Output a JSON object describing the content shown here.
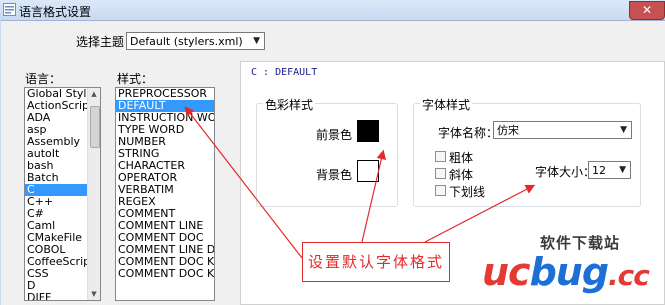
{
  "window": {
    "title": "语言格式设置",
    "close_label": "✕"
  },
  "theme": {
    "label": "选择主题",
    "selected": "Default (stylers.xml)"
  },
  "language_list": {
    "label": "语言：",
    "items": [
      "Global Styles",
      "ActionScript",
      "ADA",
      "asp",
      "Assembly",
      "autoIt",
      "bash",
      "Batch",
      "C",
      "C++",
      "C#",
      "Caml",
      "CMakeFile",
      "COBOL",
      "CoffeeScript",
      "CSS",
      "D",
      "DIFF"
    ],
    "selected_index": 8
  },
  "style_list": {
    "label": "样式：",
    "items": [
      "PREPROCESSOR",
      "DEFAULT",
      "INSTRUCTION WORD",
      "TYPE WORD",
      "NUMBER",
      "STRING",
      "CHARACTER",
      "OPERATOR",
      "VERBATIM",
      "REGEX",
      "COMMENT",
      "COMMENT LINE",
      "COMMENT DOC",
      "COMMENT LINE DOC",
      "COMMENT DOC KEYWORD",
      "COMMENT DOC KEYWORD"
    ],
    "selected_index": 1
  },
  "panel": {
    "title": "C : DEFAULT"
  },
  "color_style": {
    "caption": "色彩样式",
    "foreground_label": "前景色",
    "background_label": "背景色",
    "foreground_color": "#000000",
    "background_color": "#ffffff"
  },
  "font_style": {
    "caption": "字体样式",
    "name_label": "字体名称：",
    "name_value": "仿宋",
    "bold_label": "粗体",
    "italic_label": "斜体",
    "underline_label": "下划线",
    "size_label": "字体大小：",
    "size_value": "12"
  },
  "annotation": {
    "text": "设置默认字体格式",
    "color": "#e32a2a"
  },
  "watermark": {
    "site": "软件下载站",
    "logo_part1": "uc",
    "logo_part2": "bug",
    "logo_part3": ".cc"
  }
}
